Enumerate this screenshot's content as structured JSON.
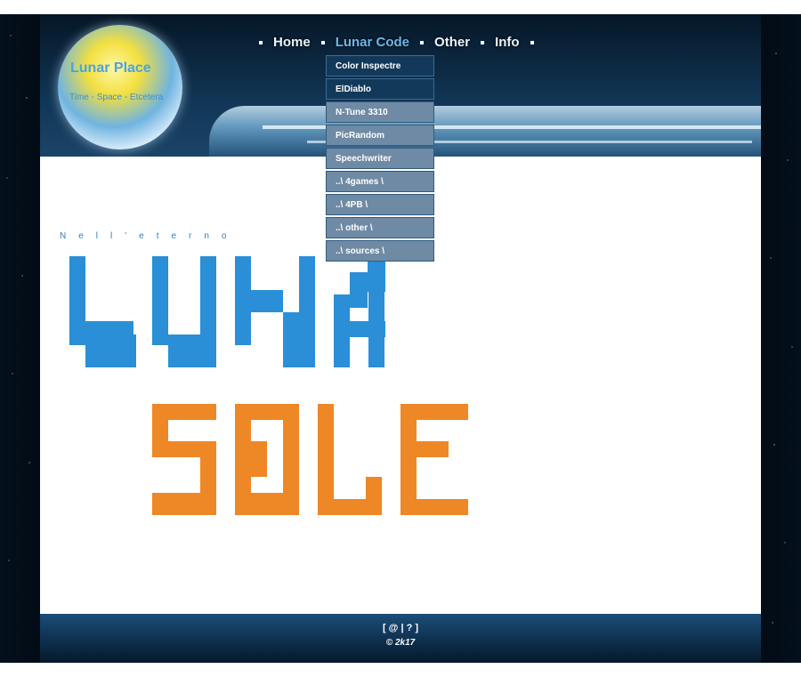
{
  "site": {
    "title": "Lunar Place",
    "subtitle": "Time - Space - Etcetera"
  },
  "nav": {
    "items": [
      {
        "label": "Home"
      },
      {
        "label": "Lunar Code"
      },
      {
        "label": "Other"
      },
      {
        "label": "Info"
      }
    ],
    "active": "Lunar Code"
  },
  "dropdown": {
    "items": [
      {
        "label": "Color Inspectre"
      },
      {
        "label": "ElDiablo"
      },
      {
        "label": "N-Tune 3310"
      },
      {
        "label": "PicRandom"
      },
      {
        "label": "Speechwriter"
      },
      {
        "label": "..\\ 4games \\"
      },
      {
        "label": "..\\ 4PB \\"
      },
      {
        "label": "..\\ other \\"
      },
      {
        "label": "..\\ sources \\"
      }
    ]
  },
  "content": {
    "tagline": "Nell'eterno",
    "logo_line1": "LUNA",
    "logo_line2": "SOLE"
  },
  "footer": {
    "links": "[ @ | ? ]",
    "copyright": "© 2k17"
  },
  "colors": {
    "logo_blue": "#2a8fd6",
    "logo_orange": "#ee8725",
    "nav_active": "#6ab8ea"
  }
}
